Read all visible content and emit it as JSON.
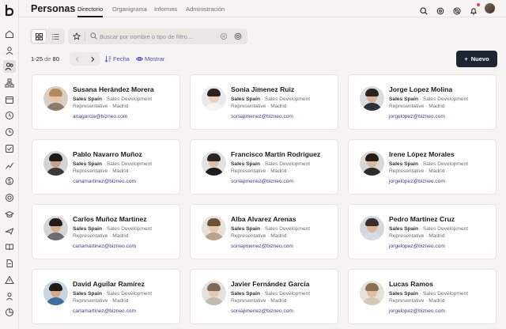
{
  "header": {
    "title": "Personas",
    "tabs": [
      {
        "label": "Directorio",
        "active": true
      },
      {
        "label": "Organigrama",
        "active": false
      },
      {
        "label": "Informes",
        "active": false
      },
      {
        "label": "Administración",
        "active": false
      }
    ],
    "icons": [
      "search-icon",
      "apps-icon",
      "help-icon",
      "bell-icon",
      "user-avatar"
    ]
  },
  "sidebar": {
    "icons": [
      "home-icon",
      "profile-icon",
      "people-icon",
      "org-icon",
      "calendar-icon",
      "clock-icon",
      "time-icon",
      "tasks-icon",
      "chart-icon",
      "money-icon",
      "target-icon",
      "cap-icon",
      "travel-icon",
      "learning-icon",
      "docs-icon",
      "warning-icon",
      "person-icon",
      "pie-icon"
    ],
    "active_index": 2
  },
  "toolbar": {
    "search_placeholder": "Buscar por nombre o tipo de filtro...",
    "pager_range": "1-25",
    "pager_of": "de",
    "pager_total": "80",
    "sort_label": "Fecha",
    "show_label": "Mostrar",
    "new_label": "Nuevo"
  },
  "colors": {
    "accent": "#4b4fb8",
    "primary_button": "#1e2433",
    "email": "#3a3f8f"
  },
  "people": [
    {
      "name": "Susana Herández Morera",
      "dept": "Sales Spain",
      "dept_rest": "· Sales Development",
      "role": "Representative · Madrid",
      "email": "anagarcia@bizneo.com"
    },
    {
      "name": "Sonia Jimenez Ruiz",
      "dept": "Sales Spain",
      "dept_rest": "· Sales Development",
      "role": "Representative · Madrid",
      "email": "soniajimenez@bizneo.com"
    },
    {
      "name": "Jorge Lopez Molina",
      "dept": "Sales Spain",
      "dept_rest": "· Sales Development",
      "role": "Representative · Madrid",
      "email": "jorgelopez@bizneo.com"
    },
    {
      "name": "Pablo Navarro Muñoz",
      "dept": "Sales Spain",
      "dept_rest": "· Sales Development",
      "role": "Representative · Madrid",
      "email": "carlamartinez@bizneo.com"
    },
    {
      "name": "Francisco Martín Rodriguez",
      "dept": "Sales Spain",
      "dept_rest": "· Sales Development",
      "role": "Representative · Madrid",
      "email": "soniajimenez@bizneo.com"
    },
    {
      "name": "Irene López Morales",
      "dept": "Sales Spain",
      "dept_rest": "· Sales Development",
      "role": "Representative · Madrid",
      "email": "jorgelopez@bizneo.com"
    },
    {
      "name": "Carlos Muñoz Martinez",
      "dept": "Sales Spain",
      "dept_rest": "· Sales Development",
      "role": "Representative · Madrid",
      "email": "carlamartinez@bizneo.com"
    },
    {
      "name": "Alba  Alvarez Arenas",
      "dept": "Sales Spain",
      "dept_rest": "· Sales Development",
      "role": "Representative · Madrid",
      "email": "soniajimenez@bizneo.com"
    },
    {
      "name": "Pedro Martínez Cruz",
      "dept": "Sales Spain",
      "dept_rest": "· Sales Development",
      "role": "Representative · Madrid",
      "email": "jorgelopez@bizneo.com"
    },
    {
      "name": "David Aguilar Ramírez",
      "dept": "Sales Spain",
      "dept_rest": "· Sales Development",
      "role": "Representative · Madrid",
      "email": "carlamartinez@bizneo.com"
    },
    {
      "name": "Javier Fernández García",
      "dept": "Sales Spain",
      "dept_rest": "· Sales Development",
      "role": "Representative · Madrid",
      "email": "soniajimenez@bizneo.com"
    },
    {
      "name": "Lucas Ramos",
      "dept": "Sales Spain",
      "dept_rest": "· Sales Development",
      "role": "Representative · Madrid",
      "email": "jorgelopez@bizneo.com"
    }
  ]
}
